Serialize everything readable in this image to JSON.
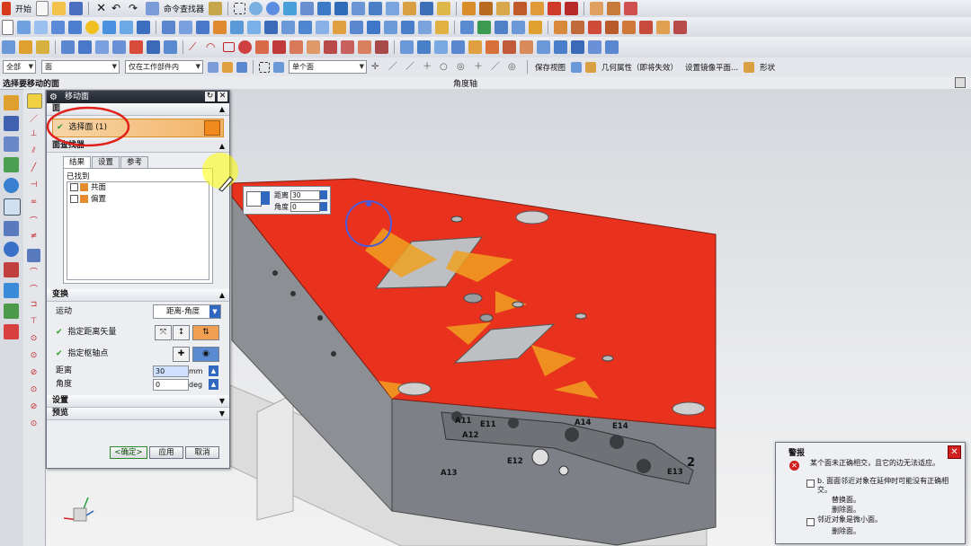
{
  "toolbar_row1": {
    "start_label": "开始",
    "command_finder": "命令查找器"
  },
  "toolbar_row4": {
    "filter_type": "全部",
    "select_mode": "面",
    "scope": "仅在工作部件内",
    "face_rule": "单个面",
    "save_view": "保存视图",
    "geometry_props": "几何属性（即将失效）",
    "set_mirror": "设置镜像平面...",
    "shape": "形状"
  },
  "cue": {
    "prompt": "选择要移动的面",
    "status": "角度轴"
  },
  "dialog": {
    "title": "移动面",
    "group_face": "面",
    "select_face": "选择面 (1)",
    "face_finder": "面查找器",
    "tabs": [
      "结果",
      "设置",
      "参考"
    ],
    "found_label": "已找到",
    "found_items": [
      "共面",
      "偏置"
    ],
    "group_transform": "变换",
    "motion_label": "运动",
    "motion_value": "距离-角度",
    "distance_vector": "指定距离矢量",
    "pivot_point": "指定枢轴点",
    "distance_label": "距离",
    "distance_value": "30",
    "distance_unit": "mm",
    "angle_label": "角度",
    "angle_value": "0",
    "angle_unit": "deg",
    "group_settings": "设置",
    "group_preview": "预览",
    "ok": "<确定>",
    "apply": "应用",
    "cancel": "取消"
  },
  "popup": {
    "distance_label": "距离",
    "distance_value": "30",
    "angle_label": "角度",
    "angle_value": "0"
  },
  "part_labels": [
    "A11",
    "E11",
    "A12",
    "E12",
    "A13",
    "A14",
    "E14",
    "E13",
    "2"
  ],
  "alert": {
    "title": "警报",
    "line1": "某个面未正确相交，且它的边无法适应。",
    "line2": "b. 面面邻近对象在延伸时可能没有正确相交。",
    "fix1": "替换面。",
    "fix2": "删除面。",
    "line3": "邻近对象是微小面。",
    "fix3": "删除面。"
  },
  "colors": {
    "face_highlight": "#e8321e",
    "dialog_title_bg": "#2a2e36",
    "selection_orange": "#f2b366"
  }
}
